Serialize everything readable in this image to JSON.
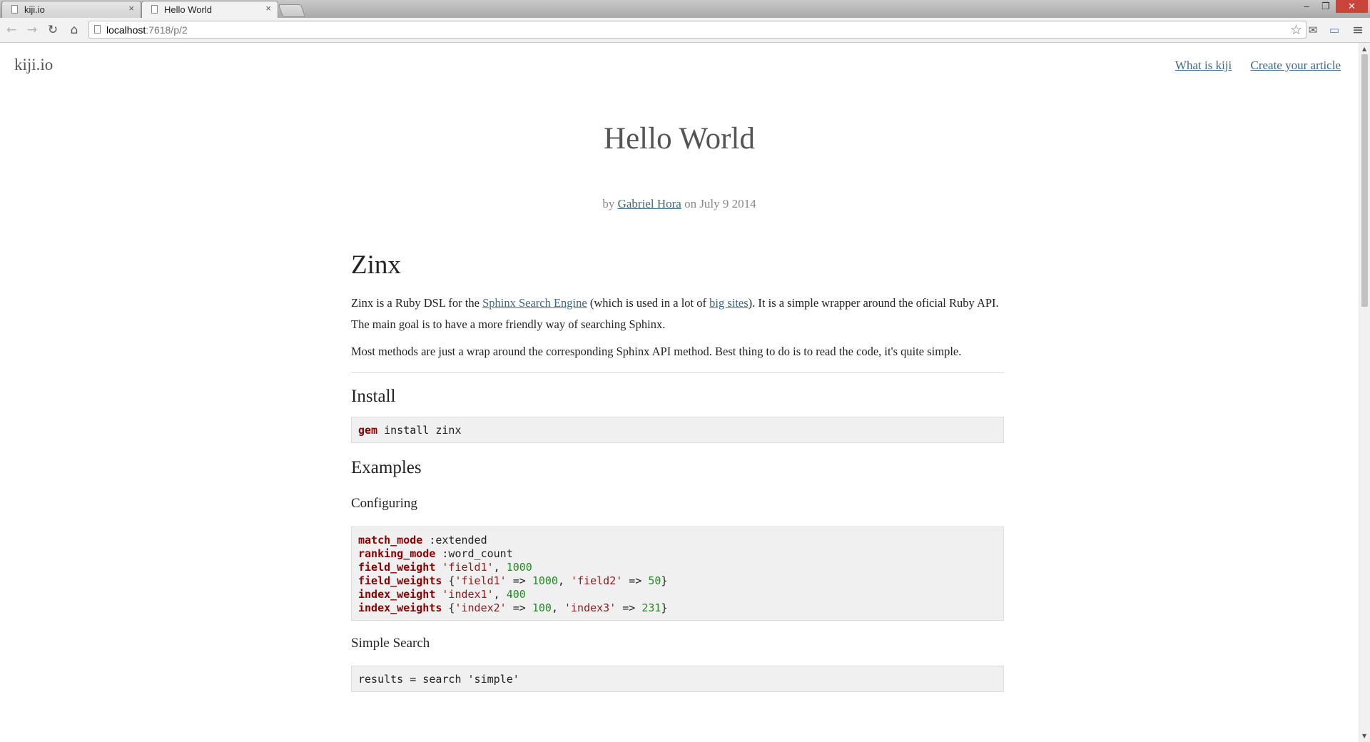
{
  "browser": {
    "tabs": [
      {
        "title": "kiji.io",
        "active": false,
        "close": "×"
      },
      {
        "title": "Hello World",
        "active": true,
        "close": "×"
      }
    ],
    "window_controls": {
      "minimize": "–",
      "restore": "❐",
      "close": "✕"
    },
    "url_host": "localhost",
    "url_path": ":7618/p/2",
    "icons": {
      "back": "←",
      "forward": "→",
      "reload": "↻",
      "home": "⌂",
      "star": "☆",
      "mail": "✉",
      "cast": "▭",
      "menu": "≡"
    }
  },
  "site": {
    "brand": "kiji.io",
    "nav": [
      {
        "label": "What is kiji"
      },
      {
        "label": "Create your article"
      }
    ]
  },
  "post": {
    "title": "Hello World",
    "byline_by": "by",
    "author": "Gabriel Hora",
    "byline_on": "on July 9 2014"
  },
  "article": {
    "heading": "Zinx",
    "p1_a": "Zinx is a Ruby DSL for the ",
    "p1_link1": "Sphinx Search Engine",
    "p1_b": " (which is used in a lot of ",
    "p1_link2": "big sites",
    "p1_c": "). It is a simple wrapper around the oficial Ruby API.",
    "p2": "The main goal is to have a more friendly way of searching Sphinx.",
    "p3": "Most methods are just a wrap around the corresponding Sphinx API method. Best thing to do is to read the code, it's quite simple.",
    "install_heading": "Install",
    "install_code": {
      "kw": "gem",
      "rest": " install zinx"
    },
    "examples_heading": "Examples",
    "configuring_heading": "Configuring",
    "config_code": [
      {
        "kw": "match_mode",
        "rest": " :extended"
      },
      {
        "kw": "ranking_mode",
        "rest": " :word_count"
      },
      {
        "kw": "field_weight",
        "rest": " 'field1', 1000"
      },
      {
        "kw": "field_weights",
        "rest": " {'field1' => 1000, 'field2' => 50}"
      },
      {
        "kw": "index_weight",
        "rest": " 'index1', 400"
      },
      {
        "kw": "index_weights",
        "rest": " {'index2' => 100, 'index3' => 231}"
      }
    ],
    "simple_search_heading": "Simple Search",
    "simple_search_code": "results = search 'simple'"
  },
  "colors": {
    "link": "#3f6783",
    "code_keyword": "#8b0000",
    "code_number": "#218c21",
    "code_bg": "#f0f0f0"
  }
}
